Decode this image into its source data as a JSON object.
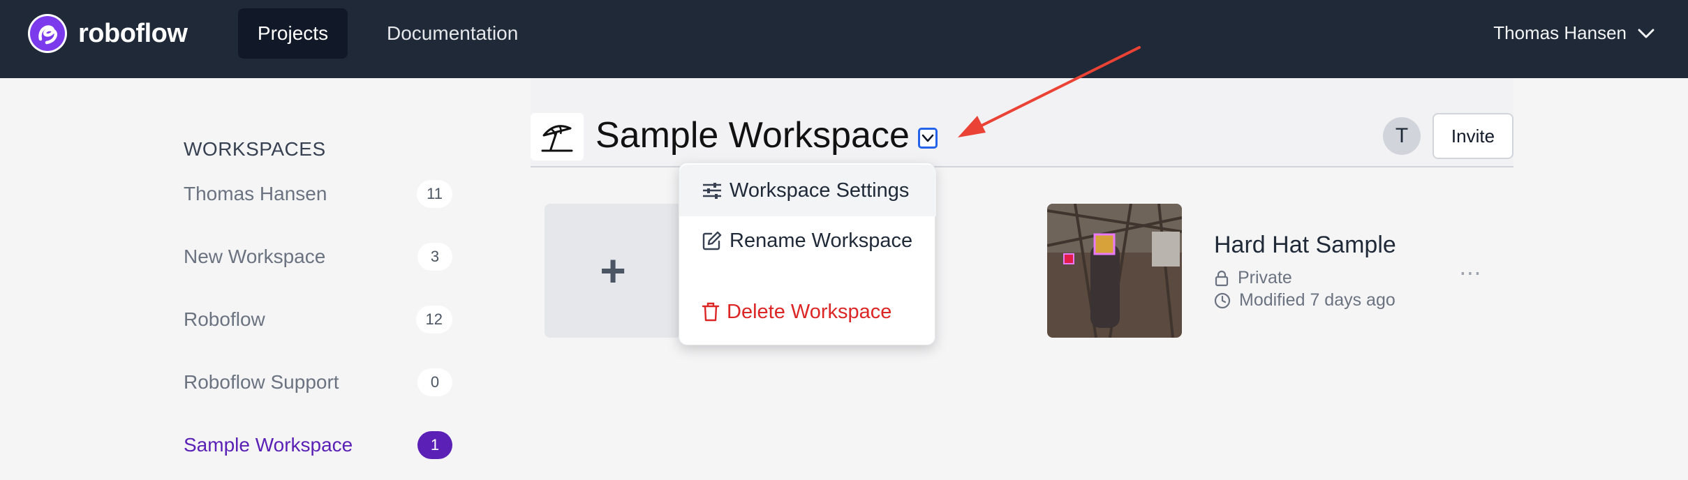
{
  "brand": {
    "name": "roboflow",
    "accent": "#5b21b6"
  },
  "nav": {
    "projects_label": "Projects",
    "documentation_label": "Documentation",
    "user_name": "Thomas Hansen"
  },
  "sidebar": {
    "heading": "WORKSPACES",
    "items": [
      {
        "label": "Thomas Hansen",
        "count": "11"
      },
      {
        "label": "New Workspace",
        "count": "3"
      },
      {
        "label": "Roboflow",
        "count": "12"
      },
      {
        "label": "Roboflow Support",
        "count": "0"
      },
      {
        "label": "Sample Workspace",
        "count": "1"
      }
    ]
  },
  "workspace": {
    "title": "Sample Workspace",
    "avatar_initial": "T",
    "invite_label": "Invite",
    "emoji_icon": "beach-umbrella-icon"
  },
  "menu": {
    "items": [
      {
        "label": "Workspace Settings",
        "icon": "sliders-icon"
      },
      {
        "label": "Rename Workspace",
        "icon": "edit-icon"
      },
      {
        "label": "Delete Workspace",
        "icon": "trash-icon"
      }
    ]
  },
  "new_project": {
    "label": "+"
  },
  "project": {
    "title": "Hard Hat Sample",
    "visibility": "Private",
    "modified": "Modified 7 days ago",
    "more": "⋯"
  }
}
